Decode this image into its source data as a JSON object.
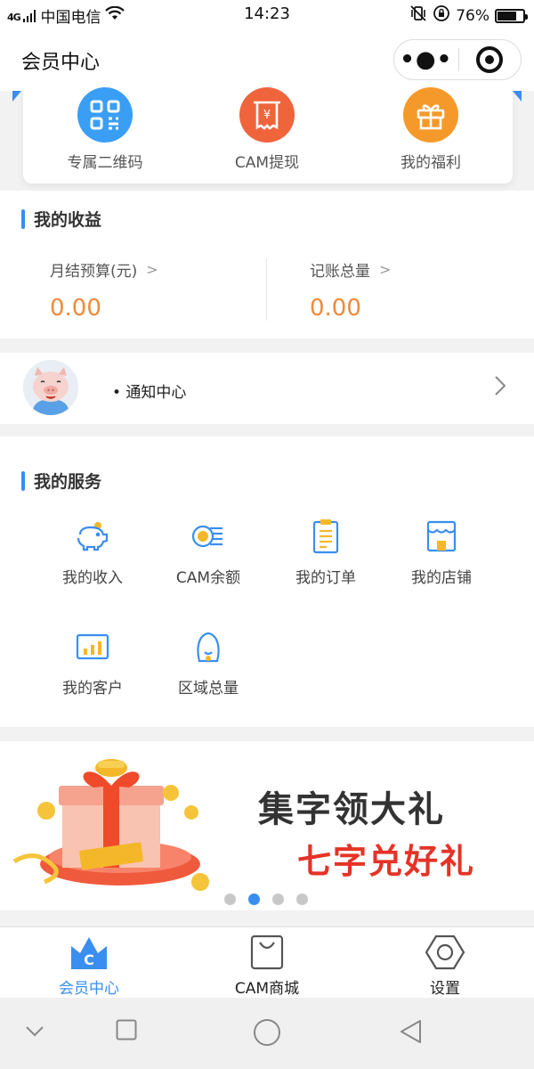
{
  "status_bar": {
    "signal": "4G",
    "carrier": "中国电信",
    "time": "14:23",
    "battery": "76%",
    "battery_level": 0.76
  },
  "navbar": {
    "title": "会员中心",
    "more_icon": "more-dots-icon",
    "close_icon": "target-icon"
  },
  "quick_actions": [
    {
      "label": "专属二维码",
      "icon": "qrcode-icon",
      "color": "#3a9ef5"
    },
    {
      "label": "CAM提现",
      "icon": "receipt-yen-icon",
      "color": "#f0643c"
    },
    {
      "label": "我的福利",
      "icon": "gift-icon",
      "color": "#f59a2a"
    }
  ],
  "earnings": {
    "title": "我的收益",
    "items": [
      {
        "label": "月结预算(元)",
        "value": "0.00"
      },
      {
        "label": "记账总量",
        "value": "0.00"
      }
    ]
  },
  "notice": {
    "label": "• 通知中心",
    "avatar": "pig-avatar"
  },
  "services": {
    "title": "我的服务",
    "items": [
      {
        "label": "我的收入",
        "icon": "piggy-bank-icon"
      },
      {
        "label": "CAM余额",
        "icon": "coin-icon"
      },
      {
        "label": "我的订单",
        "icon": "order-list-icon"
      },
      {
        "label": "我的店铺",
        "icon": "shop-icon"
      },
      {
        "label": "我的客户",
        "icon": "bar-chart-icon"
      },
      {
        "label": "区域总量",
        "icon": "region-icon"
      }
    ]
  },
  "banner": {
    "line1": "集字领大礼",
    "line2": "七字兑好礼",
    "slide_count": 4,
    "active_index": 1
  },
  "tabbar": [
    {
      "label": "会员中心",
      "icon": "crown-c-icon",
      "active": true
    },
    {
      "label": "CAM商城",
      "icon": "shopping-bag-icon",
      "active": false
    },
    {
      "label": "设置",
      "icon": "hex-nut-icon",
      "active": false
    }
  ],
  "colors": {
    "accent": "#3a8ef0",
    "value_orange": "#f08a3a",
    "banner_red": "#e53326"
  }
}
